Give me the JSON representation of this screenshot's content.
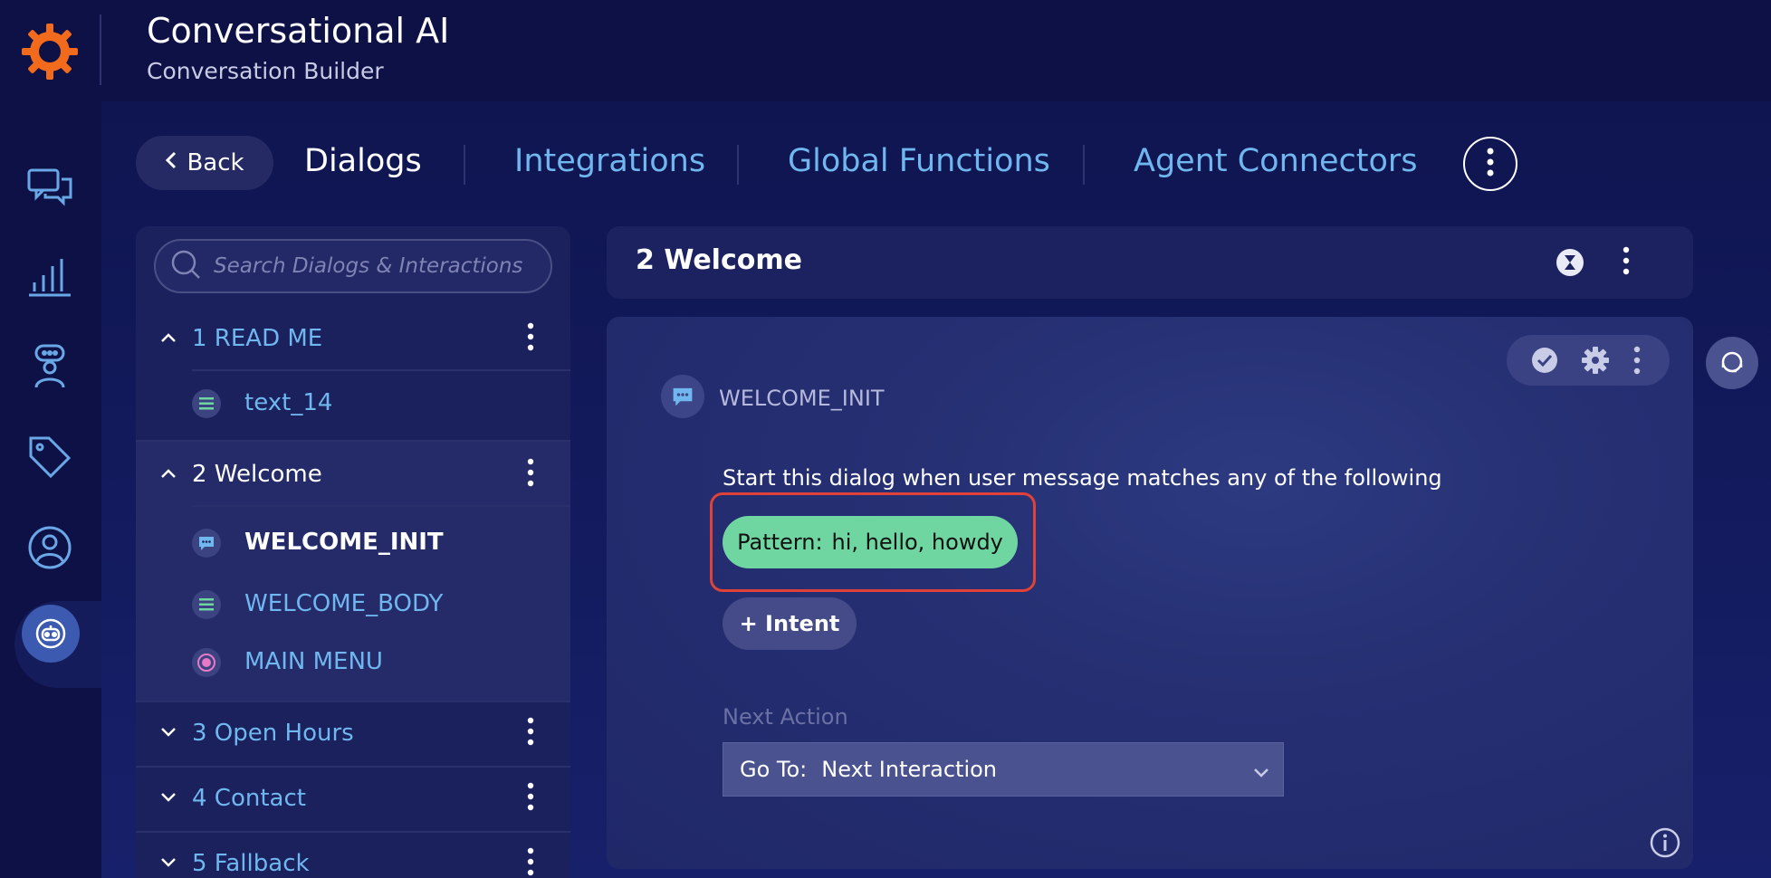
{
  "header": {
    "title": "Conversational AI",
    "subtitle": "Conversation Builder"
  },
  "leftnav": {
    "items": [
      "conversations-icon",
      "analytics-icon",
      "bot-agent-icon",
      "tags-icon",
      "user-profile-icon",
      "bot-builder-icon"
    ],
    "active": "bot-builder-icon"
  },
  "tabs": {
    "back_label": "Back",
    "items": [
      "Dialogs",
      "Integrations",
      "Global Functions",
      "Agent Connectors"
    ],
    "active": "Dialogs"
  },
  "sidebar": {
    "search_placeholder": "Search Dialogs & Interactions",
    "groups": [
      {
        "label": "1 READ ME",
        "expanded": true,
        "items": [
          {
            "label": "text_14",
            "icon": "text-icon"
          }
        ]
      },
      {
        "label": "2 Welcome",
        "expanded": true,
        "items": [
          {
            "label": "WELCOME_INIT",
            "icon": "chat-bubble-icon",
            "selected": true
          },
          {
            "label": "WELCOME_BODY",
            "icon": "text-icon"
          },
          {
            "label": "MAIN MENU",
            "icon": "radio-button-icon"
          }
        ]
      },
      {
        "label": "3 Open Hours",
        "expanded": false
      },
      {
        "label": "4 Contact",
        "expanded": false
      },
      {
        "label": "5 Fallback",
        "expanded": false
      }
    ]
  },
  "dialog_header": {
    "title": "2 Welcome"
  },
  "interaction": {
    "title": "WELCOME_INIT",
    "start_text": "Start this dialog when user message matches any of the following",
    "pattern_label": "Pattern:",
    "pattern_value": "hi, hello, howdy",
    "intent_button": "+ Intent",
    "next_action_label": "Next Action",
    "goto_label": "Go To:",
    "goto_value": "Next Interaction"
  },
  "colors": {
    "accent_orange": "#f26b1d",
    "link_blue": "#6fb7ee",
    "pattern_green": "#6fd6a2",
    "highlight_red": "#e0423a"
  }
}
